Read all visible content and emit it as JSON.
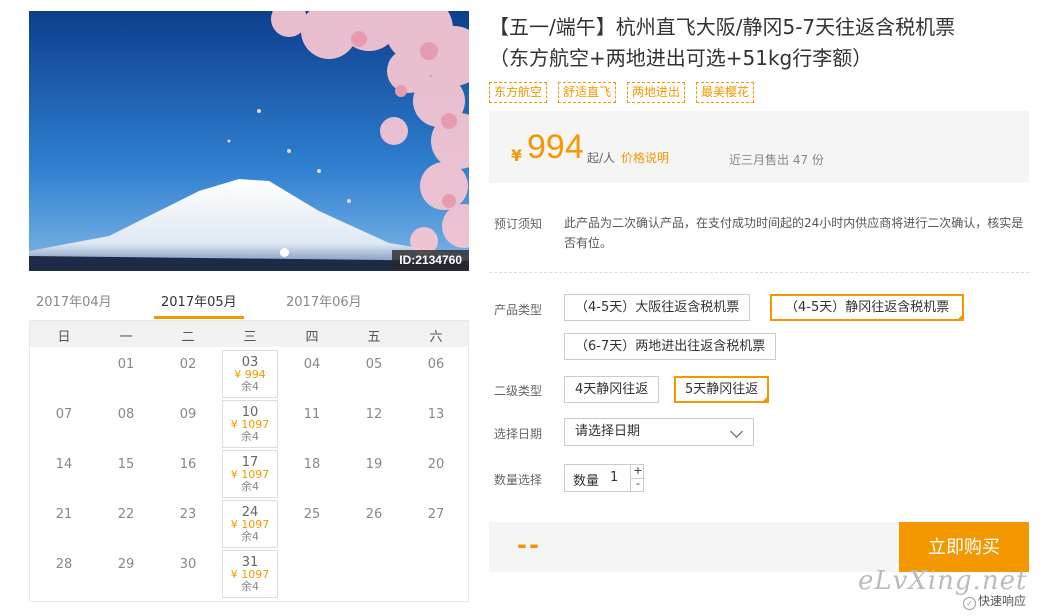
{
  "hero": {
    "id_label": "ID:2134760"
  },
  "calendar": {
    "months": [
      "2017年04月",
      "2017年05月",
      "2017年06月"
    ],
    "weekdays": [
      "日",
      "一",
      "二",
      "三",
      "四",
      "五",
      "六"
    ],
    "rows": [
      [
        "",
        "01",
        "02",
        "03",
        "04",
        "05",
        "06"
      ],
      [
        "07",
        "08",
        "09",
        "10",
        "11",
        "12",
        "13"
      ],
      [
        "14",
        "15",
        "16",
        "17",
        "18",
        "19",
        "20"
      ],
      [
        "21",
        "22",
        "23",
        "24",
        "25",
        "26",
        "27"
      ],
      [
        "28",
        "29",
        "30",
        "31",
        "",
        "",
        ""
      ]
    ],
    "available": [
      {
        "day": "03",
        "price": "¥ 994",
        "remain": "余4"
      },
      {
        "day": "10",
        "price": "¥ 1097",
        "remain": "余4"
      },
      {
        "day": "17",
        "price": "¥ 1097",
        "remain": "余4"
      },
      {
        "day": "24",
        "price": "¥ 1097",
        "remain": "余4"
      },
      {
        "day": "31",
        "price": "¥ 1097",
        "remain": "余4"
      }
    ]
  },
  "product": {
    "title_line1": "【五一/端午】杭州直飞大阪/静冈5-7天往返含税机票",
    "title_line2": "（东方航空+两地进出可选+51kg行李额）",
    "tags": [
      "东方航空",
      "舒适直飞",
      "两地进出",
      "最美樱花"
    ]
  },
  "price": {
    "symbol": "¥",
    "amount": "994",
    "unit": "起/人",
    "explain_link": "价格说明",
    "sold": "近三月售出 47 份"
  },
  "notice": {
    "label": "预订须知",
    "text": "此产品为二次确认产品，在支付成功时间起的24小时内供应商将进行二次确认，核实是否有位。"
  },
  "options": {
    "product_type_label": "产品类型",
    "product_types": [
      "（4-5天）大阪往返含税机票",
      "（4-5天）静冈往返含税机票",
      "（6-7天）两地进出往返含税机票"
    ],
    "sub_type_label": "二级类型",
    "sub_types": [
      "4天静冈往返",
      "5天静冈往返"
    ],
    "date_label": "选择日期",
    "date_placeholder": "请选择日期",
    "qty_label": "数量选择",
    "qty_inner_label": "数量",
    "qty_value": "1",
    "qty_plus": "+",
    "qty_minus": "-"
  },
  "buy": {
    "total": "--",
    "button": "立即购买"
  },
  "watermark": "eLvXing.net",
  "fast_response": "快速响应",
  "colors": {
    "accent": "#f39800"
  }
}
